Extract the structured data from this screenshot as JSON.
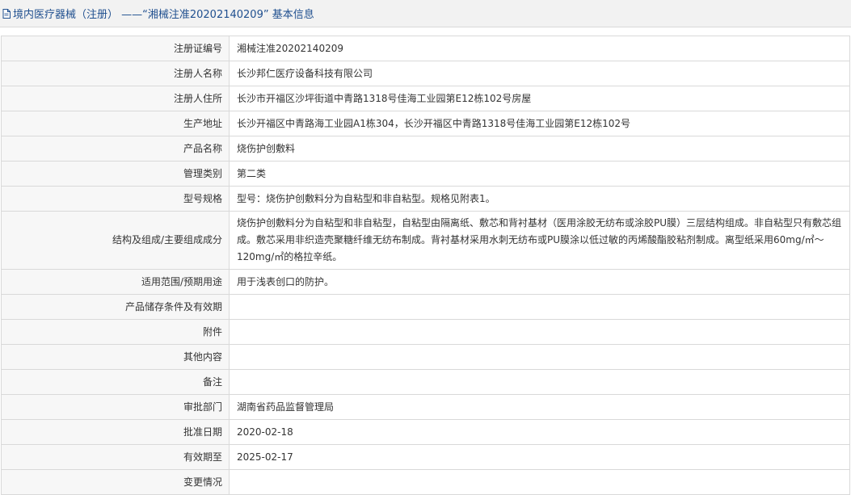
{
  "header": {
    "title": "境内医疗器械（注册） ——“湘械注准20202140209” 基本信息"
  },
  "fields": [
    {
      "label": "注册证编号",
      "value": "湘械注准20202140209"
    },
    {
      "label": "注册人名称",
      "value": "长沙邦仁医疗设备科技有限公司"
    },
    {
      "label": "注册人住所",
      "value": "长沙市开福区沙坪街道中青路1318号佳海工业园第E12栋102号房屋"
    },
    {
      "label": "生产地址",
      "value": "长沙开福区中青路海工业园A1栋304，长沙开福区中青路1318号佳海工业园第E12栋102号"
    },
    {
      "label": "产品名称",
      "value": "烧伤护创敷料"
    },
    {
      "label": "管理类别",
      "value": "第二类"
    },
    {
      "label": "型号规格",
      "value": "型号：烧伤护创敷料分为自粘型和非自粘型。规格见附表1。"
    },
    {
      "label": "结构及组成/主要组成成分",
      "value": "烧伤护创敷料分为自粘型和非自粘型，自粘型由隔离纸、敷芯和背衬基材（医用涂胶无纺布或涂胶PU膜）三层结构组成。非自粘型只有敷芯组成。敷芯采用非织造壳聚糖纤维无纺布制成。背衬基材采用水刺无纺布或PU膜涂以低过敏的丙烯酸酯胶粘剂制成。离型纸采用60mg/㎡～120mg/㎡的格拉辛纸。"
    },
    {
      "label": "适用范围/预期用途",
      "value": "用于浅表创口的防护。"
    },
    {
      "label": "产品储存条件及有效期",
      "value": ""
    },
    {
      "label": "附件",
      "value": ""
    },
    {
      "label": "其他内容",
      "value": ""
    },
    {
      "label": "备注",
      "value": ""
    },
    {
      "label": "审批部门",
      "value": "湖南省药品监督管理局"
    },
    {
      "label": "批准日期",
      "value": "2020-02-18"
    },
    {
      "label": "有效期至",
      "value": "2025-02-17"
    },
    {
      "label": "变更情况",
      "value": ""
    }
  ]
}
